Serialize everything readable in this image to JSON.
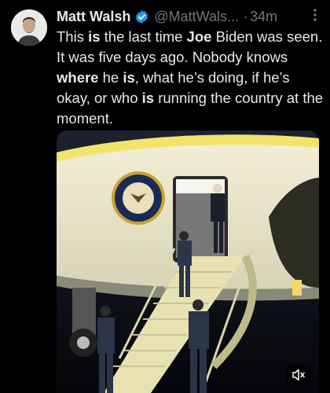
{
  "tweet": {
    "author_name": "Matt Walsh",
    "handle": "@MattWals...",
    "separator": "·",
    "timestamp": "34m",
    "more_icon": "more-icon",
    "verified_icon": "verified-badge-icon",
    "text_segments": [
      {
        "text": "This ",
        "bold": false
      },
      {
        "text": "is",
        "bold": true
      },
      {
        "text": " the last time ",
        "bold": false
      },
      {
        "text": "Joe",
        "bold": true
      },
      {
        "text": " Biden was seen. It was five days ago. Nobody knows ",
        "bold": false
      },
      {
        "text": "where",
        "bold": true
      },
      {
        "text": " he ",
        "bold": false
      },
      {
        "text": "is",
        "bold": true
      },
      {
        "text": ", what he’s doing, if he’s okay, or who ",
        "bold": false
      },
      {
        "text": "is",
        "bold": true
      },
      {
        "text": " running the country at the moment.",
        "bold": false
      }
    ]
  },
  "media": {
    "type": "video",
    "mute_icon": "muted-speaker-icon"
  },
  "colors": {
    "background": "#000000",
    "text_primary": "#e7e9ea",
    "text_secondary": "#71767b",
    "verified": "#1d9bf0"
  }
}
